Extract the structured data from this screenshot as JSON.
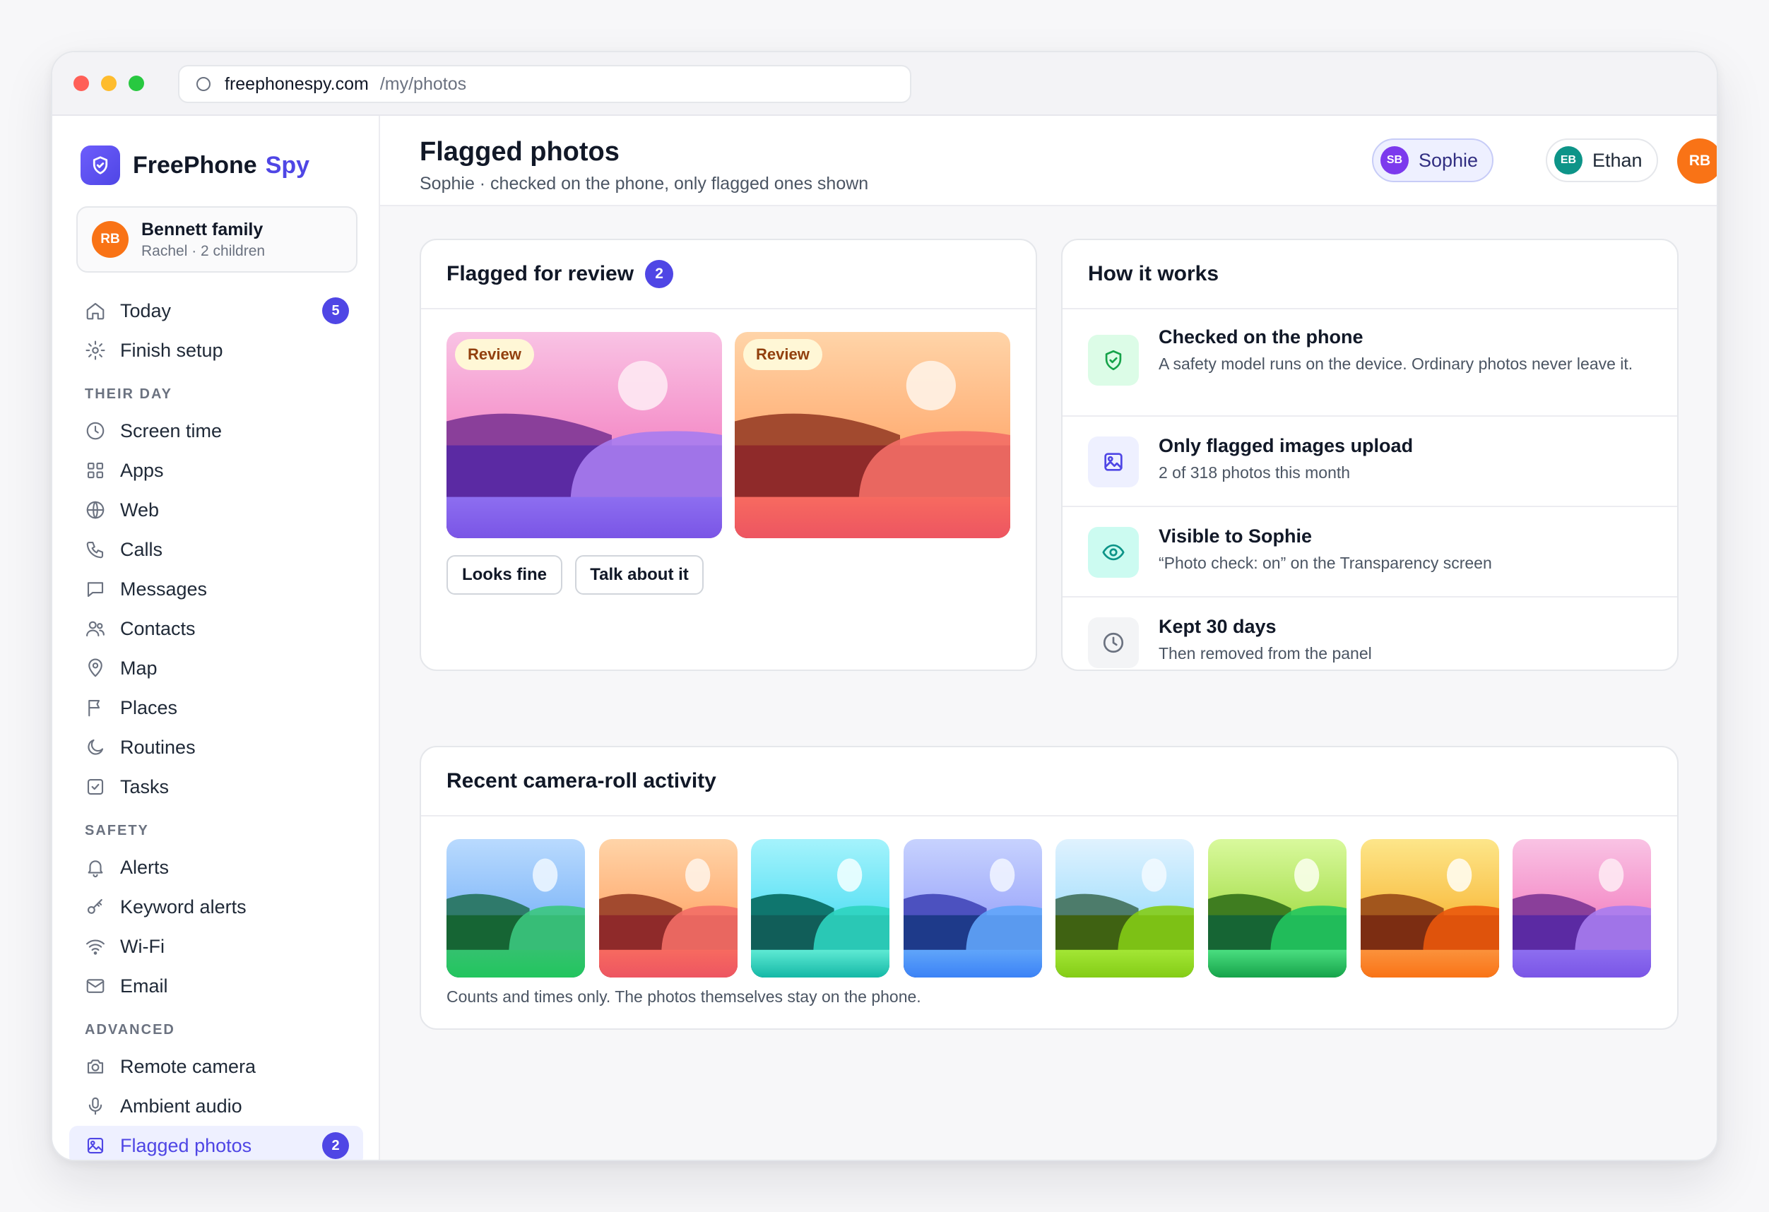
{
  "browser": {
    "url_host": "freephonespy.com",
    "url_path": "/my/photos"
  },
  "brand": {
    "name": "FreePhone",
    "accent": "Spy",
    "accent_color": "#4f46e5"
  },
  "family": {
    "initials": "RB",
    "name": "Bennett family",
    "detail": "Rachel · 2 children"
  },
  "sidebar": {
    "top_items": [
      {
        "label": "Today",
        "icon": "home-icon",
        "badge": "5"
      },
      {
        "label": "Finish setup",
        "icon": "gear-icon"
      }
    ],
    "sections": [
      {
        "title": "THEIR DAY",
        "items": [
          {
            "label": "Screen time",
            "icon": "clock-icon"
          },
          {
            "label": "Apps",
            "icon": "grid-icon"
          },
          {
            "label": "Web",
            "icon": "globe-icon"
          },
          {
            "label": "Calls",
            "icon": "phone-icon"
          },
          {
            "label": "Messages",
            "icon": "message-icon"
          },
          {
            "label": "Contacts",
            "icon": "users-icon"
          },
          {
            "label": "Map",
            "icon": "map-pin-icon"
          },
          {
            "label": "Places",
            "icon": "flag-icon"
          },
          {
            "label": "Routines",
            "icon": "moon-icon"
          },
          {
            "label": "Tasks",
            "icon": "checkbox-icon"
          }
        ]
      },
      {
        "title": "SAFETY",
        "items": [
          {
            "label": "Alerts",
            "icon": "bell-icon"
          },
          {
            "label": "Keyword alerts",
            "icon": "key-icon"
          },
          {
            "label": "Wi-Fi",
            "icon": "wifi-icon"
          },
          {
            "label": "Email",
            "icon": "mail-icon"
          }
        ]
      },
      {
        "title": "ADVANCED",
        "items": [
          {
            "label": "Remote camera",
            "icon": "camera-icon"
          },
          {
            "label": "Ambient audio",
            "icon": "microphone-icon"
          },
          {
            "label": "Flagged photos",
            "icon": "image-icon",
            "badge": "2",
            "active": true
          }
        ]
      }
    ]
  },
  "header": {
    "title": "Flagged photos",
    "subtitle": "Sophie · checked on the phone, only flagged ones shown",
    "children": [
      {
        "initials": "SB",
        "name": "Sophie",
        "color": "#7c3aed",
        "selected": true
      },
      {
        "initials": "EB",
        "name": "Ethan",
        "color": "#0d9488",
        "selected": false
      }
    ],
    "user_initials": "RB"
  },
  "flagged": {
    "title": "Flagged for review",
    "count": "2",
    "photos": [
      {
        "tag": "Review",
        "palette": "pink"
      },
      {
        "tag": "Review",
        "palette": "orange"
      }
    ],
    "actions": {
      "looks_fine": "Looks fine",
      "talk_about_it": "Talk about it"
    }
  },
  "how_it_works": {
    "title": "How it works",
    "rows": [
      {
        "title": "Checked on the phone",
        "detail": "A safety model runs on the device. Ordinary photos never leave it.",
        "icon": "shield-check-icon",
        "tint": "#dcfce7",
        "color": "#16a34a"
      },
      {
        "title": "Only flagged images upload",
        "detail": "2 of 318 photos this month",
        "icon": "image-icon",
        "tint": "#eef0ff",
        "color": "#4f46e5"
      },
      {
        "title": "Visible to Sophie",
        "detail": "“Photo check: on” on the Transparency screen",
        "icon": "eye-icon",
        "tint": "#ccfbf1",
        "color": "#0d9488"
      },
      {
        "title": "Kept 30 days",
        "detail": "Then removed from the panel",
        "icon": "clock-icon",
        "tint": "#f3f4f6",
        "color": "#6b7280"
      }
    ]
  },
  "recent": {
    "title": "Recent camera-roll activity",
    "thumbs": [
      "blue",
      "orange",
      "teal",
      "indigo",
      "sky",
      "lime",
      "amber",
      "pink"
    ],
    "note": "Counts and times only. The photos themselves stay on the phone."
  }
}
